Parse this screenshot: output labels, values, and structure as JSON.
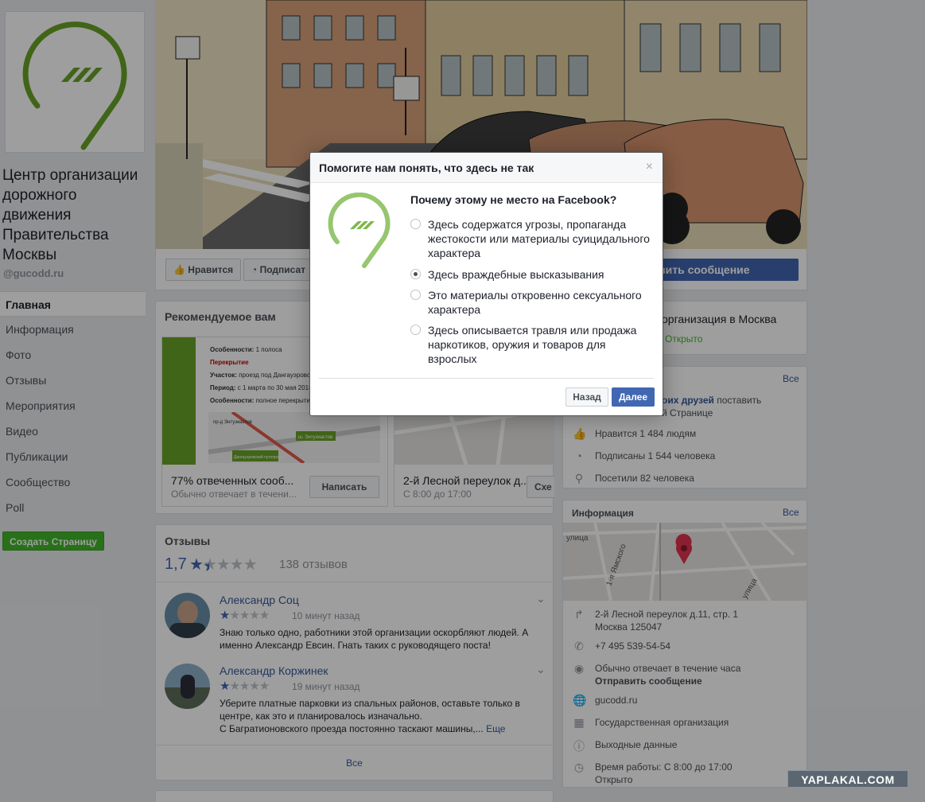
{
  "page": {
    "name": "Центр организации дорожного движения Правительства Москвы",
    "handle": "@gucodd.ru",
    "nav": [
      "Главная",
      "Информация",
      "Фото",
      "Отзывы",
      "Мероприятия",
      "Видео",
      "Публикации",
      "Сообщество",
      "Poll"
    ],
    "create_page": "Создать Страницу",
    "brand_green": "#6aa427"
  },
  "actions": {
    "like": "Нравится",
    "subscribe": "Подписат",
    "send_message": "вить сообщение"
  },
  "recommended": {
    "title": "Рекомендуемое вам",
    "card1": {
      "title": "77% отвеченных сооб...",
      "subtitle": "Обычно отвечает в течени...",
      "button": "Написать",
      "flyer": {
        "l1": "Особенности:",
        "l1v": "1 полоса",
        "l2": "Перекрытие",
        "l3": "Участок:",
        "l3v": "проезд под Дангауэровски пут...",
        "l4": "Период:",
        "l4v": "с 1 марта по 30 мая 2018 года",
        "l5": "Особенности:",
        "l5v": "полное перекрытие",
        "m1": "пр-д Энтузиастов",
        "m2": "ш. Энтузиастов",
        "m3": "Дангауэровский путепровод"
      }
    },
    "card2": {
      "title": "2-й Лесной переулок д...",
      "subtitle": "С 8:00 до 17:00",
      "button": "Схе"
    }
  },
  "reviews": {
    "title": "Отзывы",
    "rating": "1,7",
    "count": "138 отзывов",
    "rating_value": 1.7,
    "items": [
      {
        "author": "Александр Соц",
        "stars": 1,
        "time": "10 минут назад",
        "text": "Знаю только одно, работники этой организации оскорбляют людей. А именно Александр Евсин. Гнать таких с руководящего поста!"
      },
      {
        "author": "Александр Коржинек",
        "stars": 1,
        "time": "19 минут назад",
        "text1": "Уберите платные парковки из спальных районов, оставьте только в центре, как это и планировалось изначально.",
        "text2": "С Багратионовского проезда постоянно таскают машины,...",
        "more": "Еще"
      }
    ],
    "all": "Все"
  },
  "right": {
    "category": "организация в Москва",
    "status": "Открыто",
    "community": {
      "all": "Все",
      "friends_a": "оих друзей",
      "friends_b": "поставить",
      "friends_c": "й Странице",
      "likes": "Нравится 1 484 людям",
      "follows": "Подписаны 1 544 человека",
      "visits": "Посетили 82 человека"
    },
    "info": {
      "title": "Информация",
      "all": "Все",
      "street1": "улица",
      "street2": "1-я Ямского",
      "street3": "улица",
      "address1": "2-й Лесной переулок д.11, стр. 1",
      "address2": "Москва 125047",
      "phone": "+7 495 539-54-54",
      "reply": "Обычно отвечает в течение часа",
      "send": "Отправить сообщение",
      "site": "gucodd.ru",
      "type": "Государственная организация",
      "output": "Выходные данные",
      "hours": "Время работы: С 8:00 до 17:00",
      "open": "Открыто"
    }
  },
  "modal": {
    "title": "Помогите нам понять, что здесь не так",
    "close": "×",
    "question": "Почему этому не место на Facebook?",
    "options": [
      "Здесь содержатся угрозы, пропаганда жестокости или материалы суицидального характера",
      "Здесь враждебные высказывания",
      "Это материалы откровенно сексуального характера",
      "Здесь описывается травля или продажа наркотиков, оружия и товаров для взрослых"
    ],
    "selected_index": 1,
    "back": "Назад",
    "next": "Далее"
  },
  "watermark": "YAPLAKAL.COM"
}
